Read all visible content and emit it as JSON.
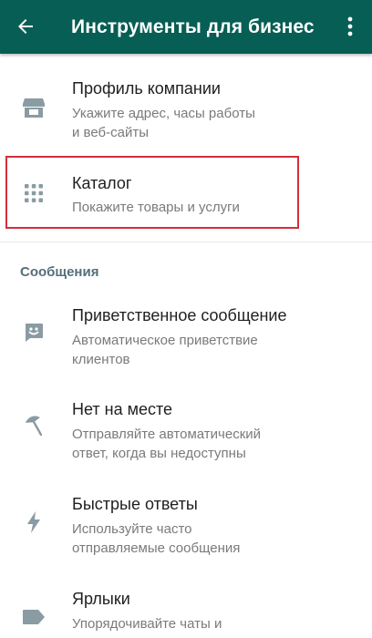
{
  "appbar": {
    "title": "Инструменты для бизнеса",
    "back_icon": "arrow-left-icon",
    "more_icon": "more-vertical-icon"
  },
  "items": [
    {
      "title": "Профиль компании",
      "subtitle": "Укажите адрес, часы работы\nи веб-сайты",
      "icon": "storefront-icon"
    },
    {
      "title": "Каталог",
      "subtitle": "Покажите товары и услуги",
      "icon": "grid-dots-icon"
    }
  ],
  "section": {
    "title": "Сообщения"
  },
  "messages": [
    {
      "title": "Приветственное сообщение",
      "subtitle": "Автоматическое приветствие\nклиентов",
      "icon": "greeting-chat-icon"
    },
    {
      "title": "Нет на месте",
      "subtitle": "Отправляйте автоматический\nответ, когда вы недоступны",
      "icon": "beach-umbrella-icon"
    },
    {
      "title": "Быстрые ответы",
      "subtitle": "Используйте часто\nотправляемые сообщения",
      "icon": "lightning-icon"
    },
    {
      "title": "Ярлыки",
      "subtitle": "Упорядочивайте чаты и\nклиентов",
      "icon": "label-tag-icon"
    }
  ],
  "colors": {
    "appbar": "#075e54",
    "icon": "#8a9ba3",
    "highlight": "#d32f3b",
    "section": "#546e7a"
  }
}
